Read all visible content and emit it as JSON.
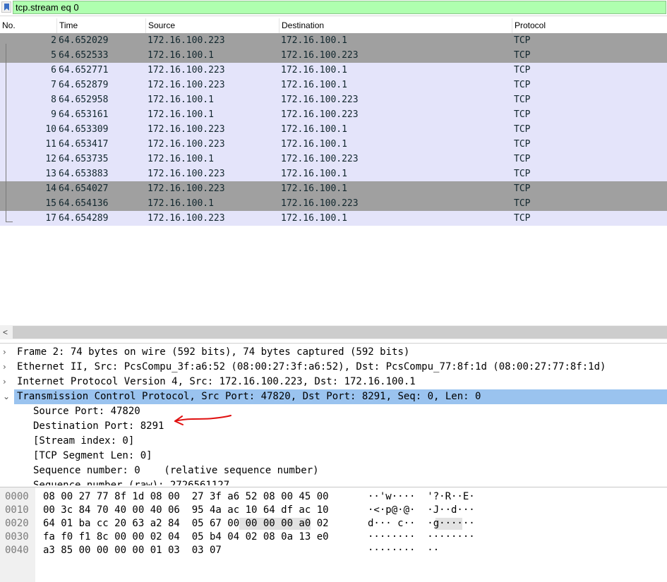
{
  "filter": {
    "value": "tcp.stream eq 0"
  },
  "packet_list": {
    "columns": [
      "No.",
      "Time",
      "Source",
      "Destination",
      "Protocol"
    ],
    "rows": [
      {
        "no": "2",
        "time": "64.652029",
        "src": "172.16.100.223",
        "dst": "172.16.100.1",
        "proto": "TCP"
      },
      {
        "no": "5",
        "time": "64.652533",
        "src": "172.16.100.1",
        "dst": "172.16.100.223",
        "proto": "TCP"
      },
      {
        "no": "6",
        "time": "64.652771",
        "src": "172.16.100.223",
        "dst": "172.16.100.1",
        "proto": "TCP"
      },
      {
        "no": "7",
        "time": "64.652879",
        "src": "172.16.100.223",
        "dst": "172.16.100.1",
        "proto": "TCP"
      },
      {
        "no": "8",
        "time": "64.652958",
        "src": "172.16.100.1",
        "dst": "172.16.100.223",
        "proto": "TCP"
      },
      {
        "no": "9",
        "time": "64.653161",
        "src": "172.16.100.1",
        "dst": "172.16.100.223",
        "proto": "TCP"
      },
      {
        "no": "10",
        "time": "64.653309",
        "src": "172.16.100.223",
        "dst": "172.16.100.1",
        "proto": "TCP"
      },
      {
        "no": "11",
        "time": "64.653417",
        "src": "172.16.100.223",
        "dst": "172.16.100.1",
        "proto": "TCP"
      },
      {
        "no": "12",
        "time": "64.653735",
        "src": "172.16.100.1",
        "dst": "172.16.100.223",
        "proto": "TCP"
      },
      {
        "no": "13",
        "time": "64.653883",
        "src": "172.16.100.223",
        "dst": "172.16.100.1",
        "proto": "TCP"
      },
      {
        "no": "14",
        "time": "64.654027",
        "src": "172.16.100.223",
        "dst": "172.16.100.1",
        "proto": "TCP"
      },
      {
        "no": "15",
        "time": "64.654136",
        "src": "172.16.100.1",
        "dst": "172.16.100.223",
        "proto": "TCP"
      },
      {
        "no": "17",
        "time": "64.654289",
        "src": "172.16.100.223",
        "dst": "172.16.100.1",
        "proto": "TCP"
      }
    ]
  },
  "details": {
    "rows": [
      {
        "text": "Frame 2: 74 bytes on wire (592 bits), 74 bytes captured (592 bits)",
        "expander": "›"
      },
      {
        "text": "Ethernet II, Src: PcsCompu_3f:a6:52 (08:00:27:3f:a6:52), Dst: PcsCompu_77:8f:1d (08:00:27:77:8f:1d)",
        "expander": "›"
      },
      {
        "text": "Internet Protocol Version 4, Src: 172.16.100.223, Dst: 172.16.100.1",
        "expander": "›"
      },
      {
        "text": "Transmission Control Protocol, Src Port: 47820, Dst Port: 8291, Seq: 0, Len: 0",
        "expander": "⌄"
      },
      {
        "text": "Source Port: 47820"
      },
      {
        "text": "Destination Port: 8291"
      },
      {
        "text": "[Stream index: 0]"
      },
      {
        "text": "[TCP Segment Len: 0]"
      },
      {
        "text": "Sequence number: 0    (relative sequence number)"
      },
      {
        "text": "Sequence number (raw): 2726561127"
      }
    ]
  },
  "bytes": {
    "rows": [
      {
        "offset": "0000",
        "hex": "08 00 27 77 8f 1d 08 00  27 3f a6 52 08 00 45 00",
        "ascii": "··'w····  '?·R··E·"
      },
      {
        "offset": "0010",
        "hex": "00 3c 84 70 40 00 40 06  95 4a ac 10 64 df ac 10",
        "ascii": "·<·p@·@·  ·J··d···"
      },
      {
        "offset": "0020",
        "hex": "64 01 ba cc 20 63 a2 84  05 67 00 00 00 00 a0 02",
        "ascii": "d··· c··  ·g······"
      },
      {
        "offset": "0030",
        "hex": "fa f0 f1 8c 00 00 02 04  05 b4 04 02 08 0a 13 e0",
        "ascii": "········  ········"
      },
      {
        "offset": "0040",
        "hex": "a3 85 00 00 00 00 01 03  03 07",
        "ascii": "········  ··"
      }
    ]
  },
  "colors": {
    "filter_bg": "#afffaf",
    "row_light": "#e4e4fa",
    "row_dark": "#a0a0a0",
    "selected": "#9ac3ef",
    "annotation": "#e01010"
  }
}
